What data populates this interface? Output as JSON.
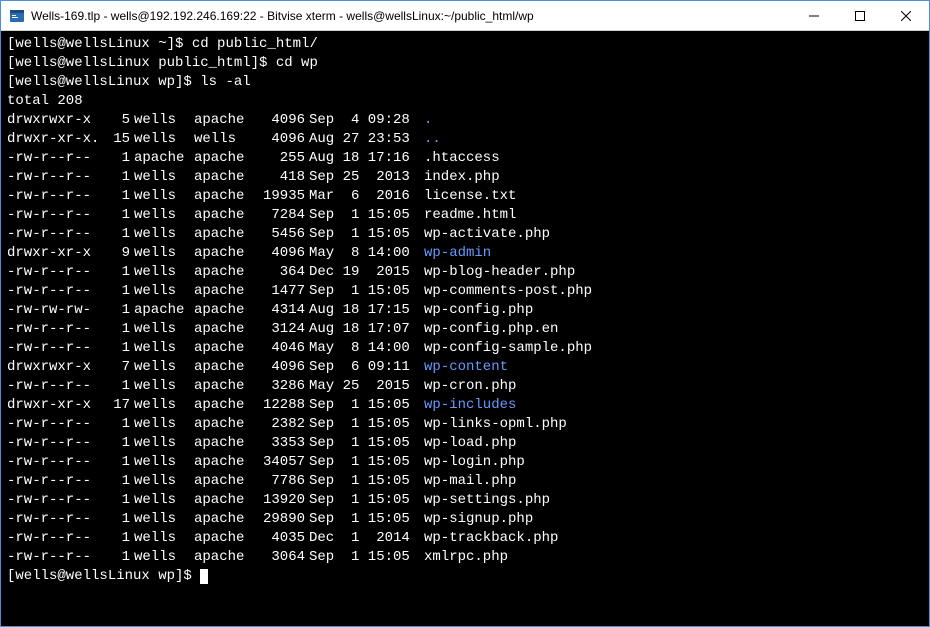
{
  "window": {
    "title": "Wells-169.tlp - wells@192.192.246.169:22 - Bitvise xterm - wells@wellsLinux:~/public_html/wp"
  },
  "prompts": [
    {
      "ps1": "[wells@wellsLinux ~]$ ",
      "cmd": "cd public_html/"
    },
    {
      "ps1": "[wells@wellsLinux public_html]$ ",
      "cmd": "cd wp"
    },
    {
      "ps1": "[wells@wellsLinux wp]$ ",
      "cmd": "ls -al"
    }
  ],
  "total_line": "total 208",
  "entries": [
    {
      "perm": "drwxrwxr-x",
      "links": "5",
      "owner": "wells",
      "group": "apache",
      "size": "4096",
      "date": "Sep  4 09:28",
      "name": ".",
      "is_dir": true
    },
    {
      "perm": "drwxr-xr-x.",
      "links": "15",
      "owner": "wells",
      "group": "wells",
      "size": "4096",
      "date": "Aug 27 23:53",
      "name": "..",
      "is_dir": true
    },
    {
      "perm": "-rw-r--r--",
      "links": "1",
      "owner": "apache",
      "group": "apache",
      "size": "255",
      "date": "Aug 18 17:16",
      "name": ".htaccess",
      "is_dir": false
    },
    {
      "perm": "-rw-r--r--",
      "links": "1",
      "owner": "wells",
      "group": "apache",
      "size": "418",
      "date": "Sep 25  2013",
      "name": "index.php",
      "is_dir": false
    },
    {
      "perm": "-rw-r--r--",
      "links": "1",
      "owner": "wells",
      "group": "apache",
      "size": "19935",
      "date": "Mar  6  2016",
      "name": "license.txt",
      "is_dir": false
    },
    {
      "perm": "-rw-r--r--",
      "links": "1",
      "owner": "wells",
      "group": "apache",
      "size": "7284",
      "date": "Sep  1 15:05",
      "name": "readme.html",
      "is_dir": false
    },
    {
      "perm": "-rw-r--r--",
      "links": "1",
      "owner": "wells",
      "group": "apache",
      "size": "5456",
      "date": "Sep  1 15:05",
      "name": "wp-activate.php",
      "is_dir": false
    },
    {
      "perm": "drwxr-xr-x",
      "links": "9",
      "owner": "wells",
      "group": "apache",
      "size": "4096",
      "date": "May  8 14:00",
      "name": "wp-admin",
      "is_dir": true
    },
    {
      "perm": "-rw-r--r--",
      "links": "1",
      "owner": "wells",
      "group": "apache",
      "size": "364",
      "date": "Dec 19  2015",
      "name": "wp-blog-header.php",
      "is_dir": false
    },
    {
      "perm": "-rw-r--r--",
      "links": "1",
      "owner": "wells",
      "group": "apache",
      "size": "1477",
      "date": "Sep  1 15:05",
      "name": "wp-comments-post.php",
      "is_dir": false
    },
    {
      "perm": "-rw-rw-rw-",
      "links": "1",
      "owner": "apache",
      "group": "apache",
      "size": "4314",
      "date": "Aug 18 17:15",
      "name": "wp-config.php",
      "is_dir": false
    },
    {
      "perm": "-rw-r--r--",
      "links": "1",
      "owner": "wells",
      "group": "apache",
      "size": "3124",
      "date": "Aug 18 17:07",
      "name": "wp-config.php.en",
      "is_dir": false
    },
    {
      "perm": "-rw-r--r--",
      "links": "1",
      "owner": "wells",
      "group": "apache",
      "size": "4046",
      "date": "May  8 14:00",
      "name": "wp-config-sample.php",
      "is_dir": false
    },
    {
      "perm": "drwxrwxr-x",
      "links": "7",
      "owner": "wells",
      "group": "apache",
      "size": "4096",
      "date": "Sep  6 09:11",
      "name": "wp-content",
      "is_dir": true
    },
    {
      "perm": "-rw-r--r--",
      "links": "1",
      "owner": "wells",
      "group": "apache",
      "size": "3286",
      "date": "May 25  2015",
      "name": "wp-cron.php",
      "is_dir": false
    },
    {
      "perm": "drwxr-xr-x",
      "links": "17",
      "owner": "wells",
      "group": "apache",
      "size": "12288",
      "date": "Sep  1 15:05",
      "name": "wp-includes",
      "is_dir": true
    },
    {
      "perm": "-rw-r--r--",
      "links": "1",
      "owner": "wells",
      "group": "apache",
      "size": "2382",
      "date": "Sep  1 15:05",
      "name": "wp-links-opml.php",
      "is_dir": false
    },
    {
      "perm": "-rw-r--r--",
      "links": "1",
      "owner": "wells",
      "group": "apache",
      "size": "3353",
      "date": "Sep  1 15:05",
      "name": "wp-load.php",
      "is_dir": false
    },
    {
      "perm": "-rw-r--r--",
      "links": "1",
      "owner": "wells",
      "group": "apache",
      "size": "34057",
      "date": "Sep  1 15:05",
      "name": "wp-login.php",
      "is_dir": false
    },
    {
      "perm": "-rw-r--r--",
      "links": "1",
      "owner": "wells",
      "group": "apache",
      "size": "7786",
      "date": "Sep  1 15:05",
      "name": "wp-mail.php",
      "is_dir": false
    },
    {
      "perm": "-rw-r--r--",
      "links": "1",
      "owner": "wells",
      "group": "apache",
      "size": "13920",
      "date": "Sep  1 15:05",
      "name": "wp-settings.php",
      "is_dir": false
    },
    {
      "perm": "-rw-r--r--",
      "links": "1",
      "owner": "wells",
      "group": "apache",
      "size": "29890",
      "date": "Sep  1 15:05",
      "name": "wp-signup.php",
      "is_dir": false
    },
    {
      "perm": "-rw-r--r--",
      "links": "1",
      "owner": "wells",
      "group": "apache",
      "size": "4035",
      "date": "Dec  1  2014",
      "name": "wp-trackback.php",
      "is_dir": false
    },
    {
      "perm": "-rw-r--r--",
      "links": "1",
      "owner": "wells",
      "group": "apache",
      "size": "3064",
      "date": "Sep  1 15:05",
      "name": "xmlrpc.php",
      "is_dir": false
    }
  ],
  "final_prompt": "[wells@wellsLinux wp]$ "
}
